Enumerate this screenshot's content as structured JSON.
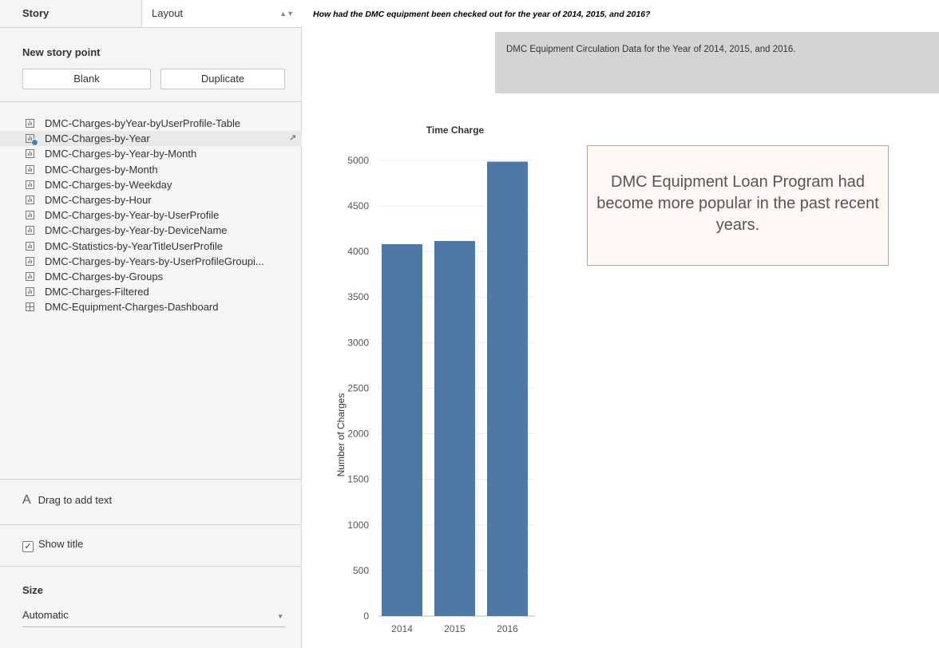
{
  "sidebar": {
    "tabs": {
      "story": "Story",
      "layout": "Layout"
    },
    "new_story_point": "New story point",
    "blank_button": "Blank",
    "duplicate_button": "Duplicate",
    "sheets": [
      {
        "label": "DMC-Charges-byYear-byUserProfile-Table",
        "icon": "worksheet-icon"
      },
      {
        "label": "DMC-Charges-by-Year",
        "icon": "worksheet-icon"
      },
      {
        "label": "DMC-Charges-by-Year-by-Month",
        "icon": "worksheet-icon"
      },
      {
        "label": "DMC-Charges-by-Month",
        "icon": "worksheet-icon"
      },
      {
        "label": "DMC-Charges-by-Weekday",
        "icon": "worksheet-icon"
      },
      {
        "label": "DMC-Charges-by-Hour",
        "icon": "worksheet-icon"
      },
      {
        "label": "DMC-Charges-by-Year-by-UserProfile",
        "icon": "worksheet-icon"
      },
      {
        "label": "DMC-Charges-by-Year-by-DeviceName",
        "icon": "worksheet-icon"
      },
      {
        "label": "DMC-Statistics-by-YearTitleUserProfile",
        "icon": "worksheet-icon"
      },
      {
        "label": "DMC-Charges-by-Years-by-UserProfileGroupi...",
        "icon": "worksheet-icon"
      },
      {
        "label": "DMC-Charges-by-Groups",
        "icon": "worksheet-icon"
      },
      {
        "label": "DMC-Charges-Filtered",
        "icon": "worksheet-icon"
      },
      {
        "label": "DMC-Equipment-Charges-Dashboard",
        "icon": "dashboard-icon"
      }
    ],
    "drag_text": "Drag to add text",
    "drag_text_icon": "A",
    "show_title": "Show title",
    "size_heading": "Size",
    "size_value": "Automatic"
  },
  "story": {
    "title": "How had the DMC equipment been checked out for the year of 2014, 2015, and 2016?",
    "caption": "DMC Equipment Circulation Data for the Year of 2014, 2015, and 2016.",
    "annotation": "DMC Equipment Loan Program had become more popular in the past recent years."
  },
  "chart_data": {
    "type": "bar",
    "title": "Time Charge",
    "xlabel": "",
    "ylabel": "Number of Charges",
    "categories": [
      "2014",
      "2015",
      "2016"
    ],
    "values": [
      4080,
      4115,
      4985
    ],
    "ylim": [
      0,
      5000
    ],
    "yticks": [
      0,
      500,
      1000,
      1500,
      2000,
      2500,
      3000,
      3500,
      4000,
      4500,
      5000
    ],
    "grid": true,
    "bar_color": "#4e79a7"
  },
  "colors": {
    "accent": "#4e79a7",
    "caption_bg": "#d4d4d4",
    "annotation_bg": "#fff8f4"
  }
}
